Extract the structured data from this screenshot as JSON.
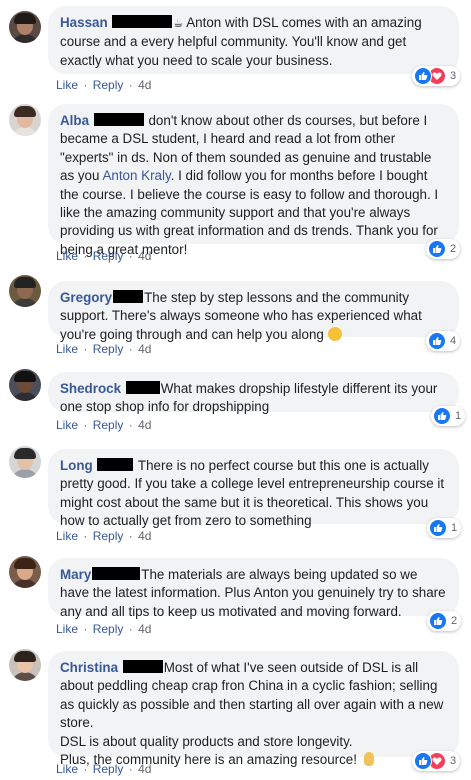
{
  "comments": [
    {
      "name": "Hassan",
      "prefix": "",
      "body": " Anton with DSL comes with an amazing course and a every helpful community. You'll know and get exactly what you need to scale your business.",
      "like": "Like",
      "reply": "Reply",
      "sep": "·",
      "time": "4d",
      "reaction_count": "3"
    },
    {
      "name": "Alba",
      "body_1": " don't know about other ds courses, but before I became a DSL student, I heard and read a lot from other \"experts\" in ds. Non of them sounded as genuine and trustable as you ",
      "mention": "Anton Kraly",
      "body_2": ". I did follow you for months before I bought the course. I believe the course is easy to follow and thorough. I like the amazing community support and that you're always providing us with great information and ds trends. Thank you for being a great mentor!",
      "like": "Like",
      "reply": "Reply",
      "sep": "·",
      "time": "4d",
      "reaction_count": "2"
    },
    {
      "name": "Gregory",
      "body": "The step by step lessons and the community support. There's always someone who has experienced what you're going through and can help you along ",
      "like": "Like",
      "reply": "Reply",
      "sep": "·",
      "time": "4d",
      "reaction_count": "4"
    },
    {
      "name": "Shedrock",
      "body": "What makes dropship lifestyle different its your one stop shop info for dropshipping",
      "like": "Like",
      "reply": "Reply",
      "sep": "·",
      "time": "4d",
      "reaction_count": "1"
    },
    {
      "name": "Long",
      "body": " There is no perfect course but this one is actually pretty good. If you take a college level entrepreneurship course it might cost about the same but it is theoretical. This shows you how to actually get from zero to something",
      "like": "Like",
      "reply": "Reply",
      "sep": "·",
      "time": "4d",
      "reaction_count": "1"
    },
    {
      "name": "Mary",
      "body": "The materials are always being updated so we have the latest information. Plus Anton you genuinely try to share any and all tips to keep us motivated and moving forward.",
      "like": "Like",
      "reply": "Reply",
      "sep": "·",
      "time": "4d",
      "reaction_count": "2"
    },
    {
      "name": "Christina",
      "body_1": "Most of what I've seen outside of DSL is all about peddling cheap crap fron China in a cyclic fashion; selling as quickly as possible and then starting all over again with a new store.",
      "body_2": "DSL is about quality products and store longevity.",
      "body_3": "Plus, the community here is an amazing resource! ",
      "like": "Like",
      "reply": "Reply",
      "sep": "·",
      "time": "4d",
      "reaction_count": "3"
    }
  ],
  "colors": {
    "name_link": "#385898",
    "bubble": "#f2f3f5",
    "like_blue": "#1877f2",
    "love_red": "#f33e58",
    "meta_gray": "#606770"
  },
  "icons": {
    "like": "thumbs-up-icon",
    "love": "heart-icon",
    "smile": "smiling-face-icon",
    "ok_hand": "ok-hand-icon"
  }
}
